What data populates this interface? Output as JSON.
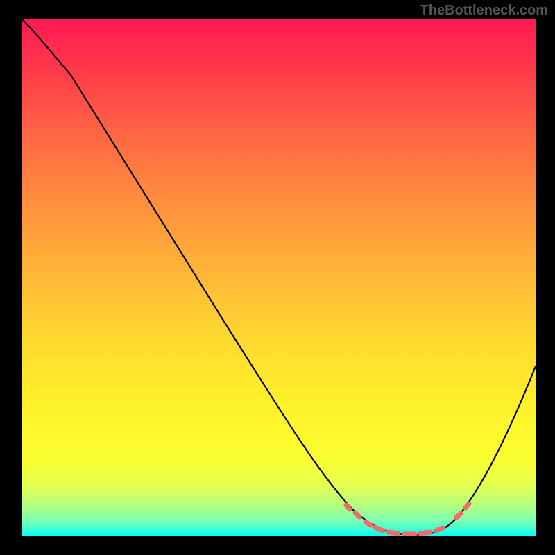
{
  "watermark": "TheBottleneck.com",
  "chart_data": {
    "type": "line",
    "title": "",
    "xlabel": "",
    "ylabel": "",
    "xlim": [
      0,
      100
    ],
    "ylim": [
      0,
      100
    ],
    "background_gradient": {
      "description": "vertical gradient red-orange-yellow-green-cyan representing bottleneck severity (red=high, green=low)",
      "stops": [
        {
          "pos": 0,
          "color": "#ff1a55"
        },
        {
          "pos": 50,
          "color": "#ffc830"
        },
        {
          "pos": 95,
          "color": "#7cffb3"
        },
        {
          "pos": 100,
          "color": "#00ffff"
        }
      ]
    },
    "series": [
      {
        "name": "bottleneck-curve",
        "x": [
          0,
          5,
          10,
          15,
          20,
          25,
          30,
          35,
          40,
          45,
          50,
          55,
          58,
          62,
          66,
          70,
          73,
          76,
          80,
          84,
          88,
          92,
          96,
          100
        ],
        "values": [
          100,
          97,
          92,
          87,
          81,
          74,
          67,
          60,
          52,
          44,
          36,
          27,
          20,
          13,
          7,
          3,
          1,
          0,
          0,
          1,
          4,
          10,
          20,
          33
        ],
        "color": "#000000",
        "note": "V-shaped curve; minimum region approx x=72..82 at y≈0"
      }
    ],
    "markers": {
      "description": "salmon dashed/dotted segments near valley floor",
      "color": "#ed6d6d",
      "points_x": [
        62,
        66,
        69,
        72,
        74,
        76,
        78,
        80,
        82,
        84,
        86,
        88
      ],
      "points_y": [
        2,
        1,
        0.5,
        0.3,
        0.2,
        0.2,
        0.2,
        0.3,
        0.5,
        1,
        2,
        4
      ]
    }
  }
}
